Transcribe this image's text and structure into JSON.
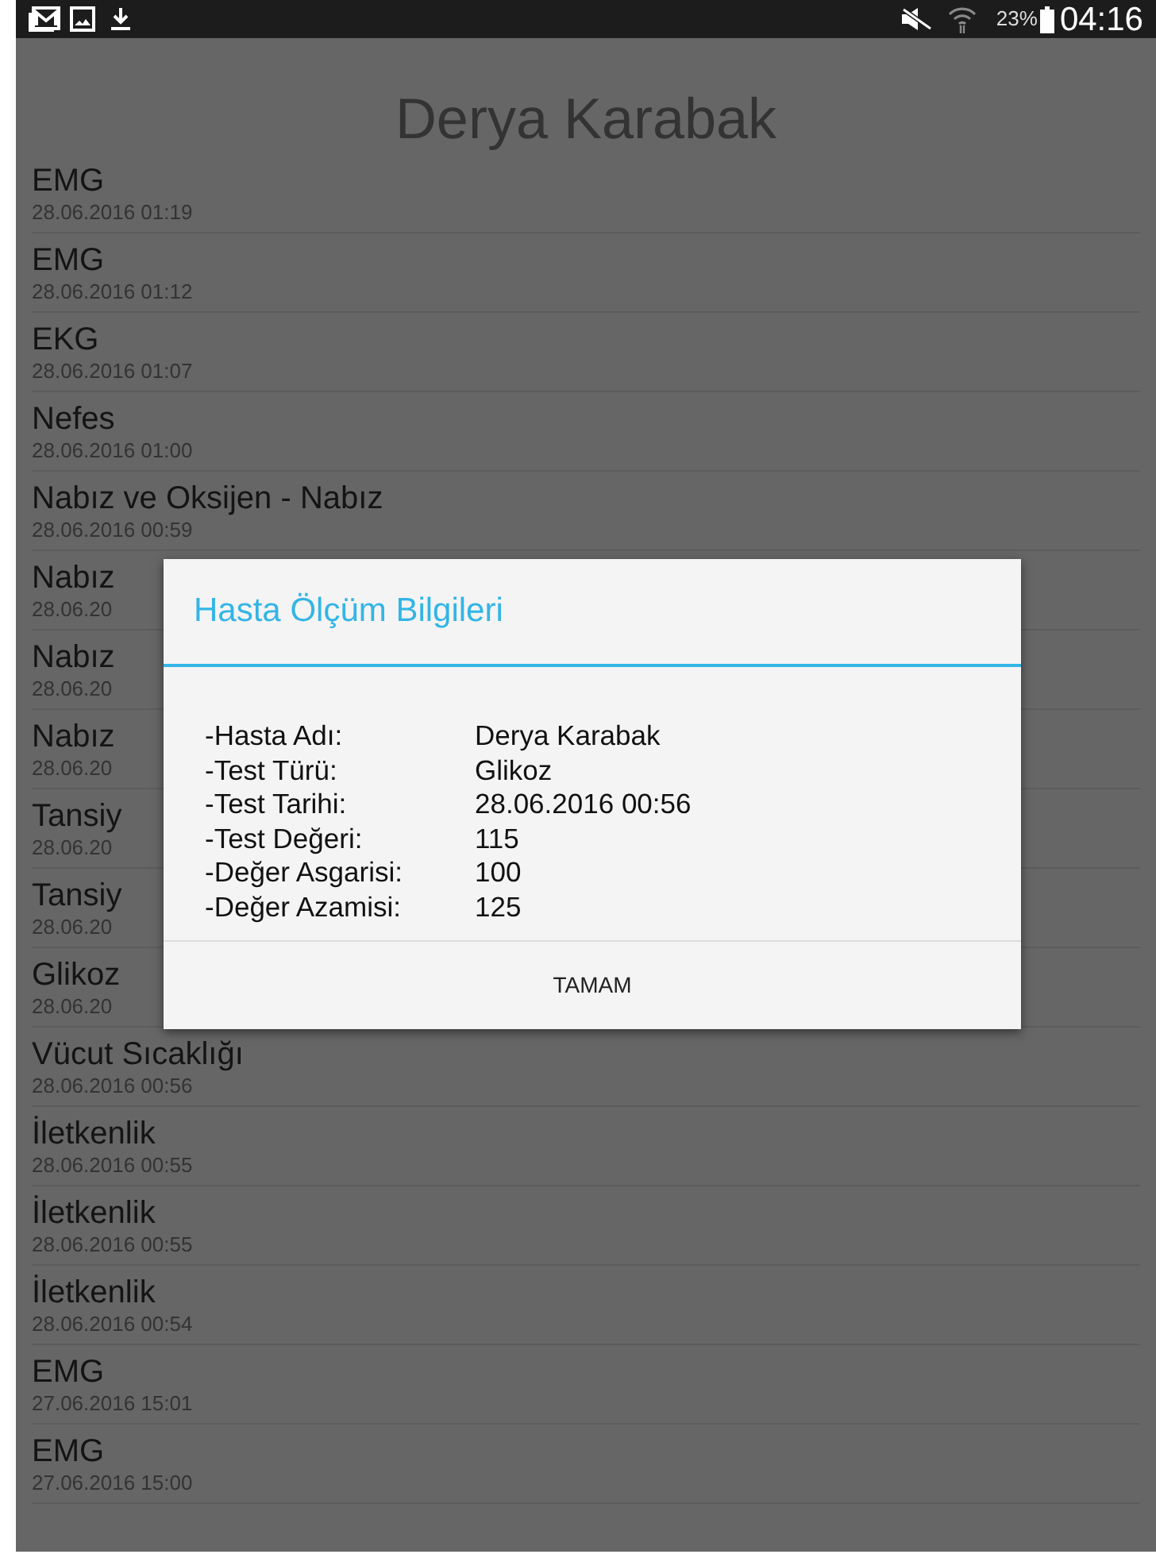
{
  "status_bar": {
    "battery": "23%",
    "time": "04:16"
  },
  "header": {
    "title": "Derya Karabak"
  },
  "records": [
    {
      "name": "EMG",
      "date": "28.06.2016 01:19"
    },
    {
      "name": "EMG",
      "date": "28.06.2016 01:12"
    },
    {
      "name": "EKG",
      "date": "28.06.2016 01:07"
    },
    {
      "name": "Nefes",
      "date": "28.06.2016 01:00"
    },
    {
      "name": "Nabız ve Oksijen - Nabız",
      "date": "28.06.2016 00:59"
    },
    {
      "name": "Nabız",
      "date": "28.06.20"
    },
    {
      "name": "Nabız",
      "date": "28.06.20"
    },
    {
      "name": "Nabız",
      "date": "28.06.20"
    },
    {
      "name": "Tansiy",
      "date": "28.06.20"
    },
    {
      "name": "Tansiy",
      "date": "28.06.20"
    },
    {
      "name": "Glikoz",
      "date": "28.06.20"
    },
    {
      "name": "Vücut Sıcaklığı",
      "date": "28.06.2016 00:56"
    },
    {
      "name": "İletkenlik",
      "date": "28.06.2016 00:55"
    },
    {
      "name": "İletkenlik",
      "date": "28.06.2016 00:55"
    },
    {
      "name": "İletkenlik",
      "date": "28.06.2016 00:54"
    },
    {
      "name": "EMG",
      "date": "27.06.2016 15:01"
    },
    {
      "name": "EMG",
      "date": "27.06.2016 15:00"
    }
  ],
  "dialog": {
    "title": "Hasta Ölçüm Bilgileri",
    "fields": [
      {
        "label": "-Hasta Adı:",
        "value": "Derya Karabak"
      },
      {
        "label": "-Test Türü:",
        "value": "Glikoz"
      },
      {
        "label": "-Test Tarihi:",
        "value": "28.06.2016 00:56"
      },
      {
        "label": "-Test Değeri:",
        "value": "115"
      },
      {
        "label": "-Değer Asgarisi:",
        "value": "100"
      },
      {
        "label": "-Değer Azamisi:",
        "value": "125"
      }
    ],
    "button": "TAMAM"
  }
}
